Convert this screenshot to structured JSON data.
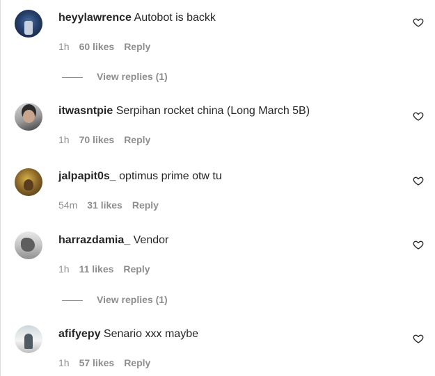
{
  "comments": [
    {
      "username": "heyylawrence",
      "text": "Autobot is backk",
      "time": "1h",
      "likes": "60 likes",
      "reply": "Reply",
      "view_replies": "View replies (1)"
    },
    {
      "username": "itwasntpie",
      "text": "Serpihan rocket china (Long March 5B)",
      "time": "1h",
      "likes": "70 likes",
      "reply": "Reply"
    },
    {
      "username": "jalpapit0s_",
      "text": "optimus prime otw tu",
      "time": "54m",
      "likes": "31 likes",
      "reply": "Reply"
    },
    {
      "username": "harrazdamia_",
      "text": "Vendor",
      "time": "1h",
      "likes": "11 likes",
      "reply": "Reply",
      "view_replies": "View replies (1)"
    },
    {
      "username": "afifyepy",
      "text": "Senario xxx maybe",
      "time": "1h",
      "likes": "57 likes",
      "reply": "Reply"
    }
  ],
  "icons": {
    "like": "heart-outline-icon"
  },
  "colors": {
    "primary_text": "#262626",
    "secondary_text": "#8e8e8e"
  }
}
